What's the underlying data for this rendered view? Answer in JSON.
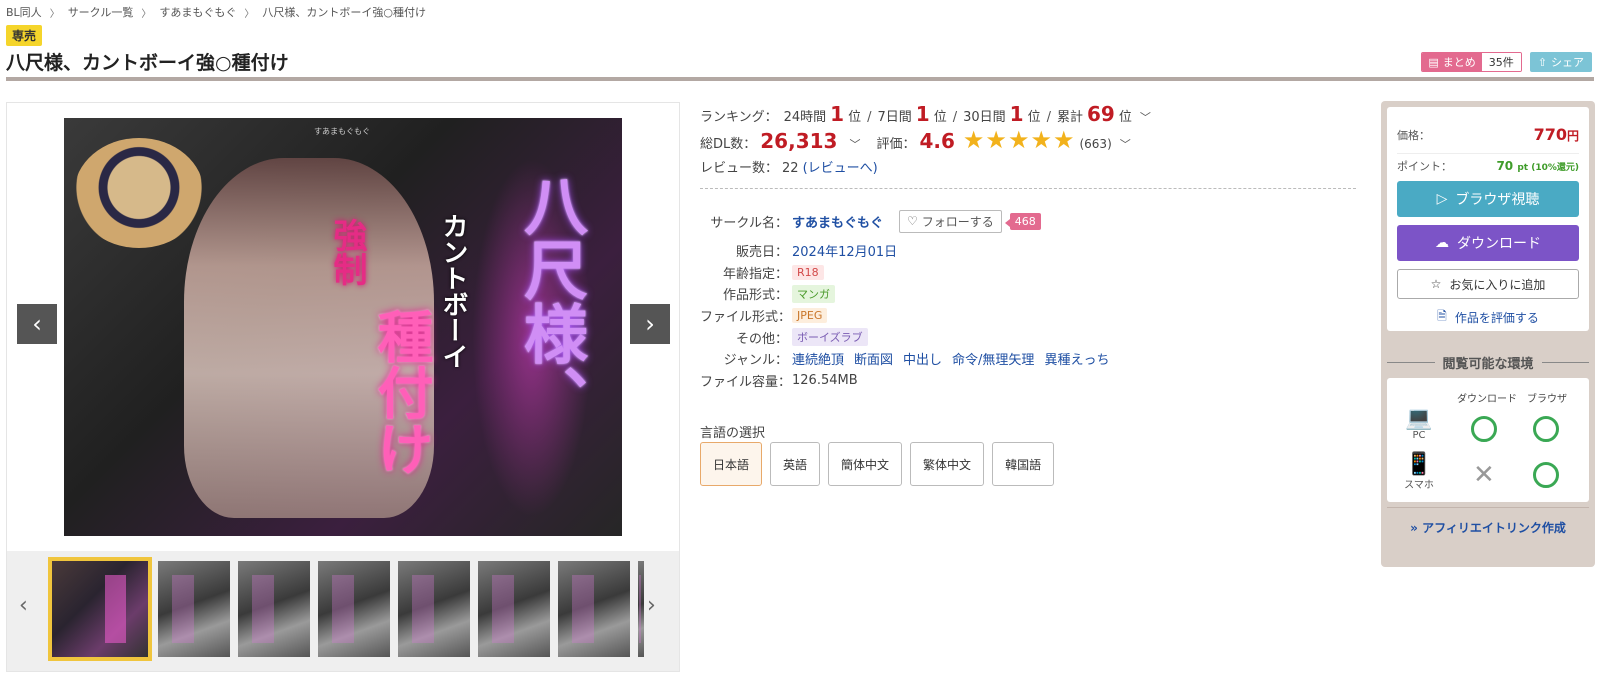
{
  "breadcrumb": [
    "BL同人",
    "サークル一覧",
    "すあまもぐもぐ",
    "八尺様、カントボーイ強○種付け"
  ],
  "badge": "専売",
  "title": "八尺様、カントボーイ強○種付け",
  "top_actions": {
    "matome_label": "まとめ",
    "matome_count": "35件",
    "share_label": "シェア"
  },
  "cover": {
    "small": "すあまもぐもぐ",
    "t1": "八尺様、",
    "t2": "カントボーイ",
    "t3": "種付け",
    "t4": "強制"
  },
  "ranking": {
    "label": "ランキング：",
    "h24_label": "24時間",
    "h24": "1",
    "d7_label": "7日間",
    "d7": "1",
    "d30_label": "30日間",
    "d30": "1",
    "total_label": "累計",
    "total": "69",
    "unit": "位"
  },
  "downloads": {
    "label": "総DL数：",
    "value": "26,313"
  },
  "rating": {
    "label": "評価：",
    "value": "4.6",
    "stars": "★★★★★",
    "count": "(663)"
  },
  "reviews": {
    "label": "レビュー数：",
    "count": "22",
    "link": "(レビューへ)"
  },
  "spec": {
    "circle_label": "サークル名：",
    "circle": "すあまもぐもぐ",
    "follow_label": "フォローする",
    "follow_count": "468",
    "date_label": "販売日：",
    "date": "2024年12月01日",
    "age_label": "年齢指定：",
    "age": "R18",
    "format_label": "作品形式：",
    "format": "マンガ",
    "file_label": "ファイル形式：",
    "file": "JPEG",
    "other_label": "その他：",
    "other": "ボーイズラブ",
    "genre_label": "ジャンル：",
    "genres": [
      "連続絶頂",
      "断面図",
      "中出し",
      "命令/無理矢理",
      "異種えっち"
    ],
    "size_label": "ファイル容量：",
    "size": "126.54MB"
  },
  "language": {
    "title": "言語の選択",
    "options": [
      "日本語",
      "英語",
      "簡体中文",
      "繁体中文",
      "韓国語"
    ],
    "selected": 0
  },
  "purchase": {
    "price_label": "価格：",
    "price": "770",
    "price_unit": "円",
    "point_label": "ポイント：",
    "point": "70",
    "point_note": "pt (10%還元)",
    "browser_label": "ブラウザ視聴",
    "download_label": "ダウンロード",
    "favorite_label": "お気に入りに追加",
    "rate_label": "作品を評価する"
  },
  "environment": {
    "title": "閲覧可能な環境",
    "col_download": "ダウンロード",
    "col_browser": "ブラウザ",
    "pc": "PC",
    "sp": "スマホ",
    "ng_mark": "✕"
  },
  "affiliate": "» アフィリエイトリンク作成",
  "colors": {
    "accent_red": "#c01c24",
    "browser_btn": "#4aaac4",
    "download_btn": "#7c54c7",
    "ok_green": "#3aa854",
    "pink": "#e36a8f"
  }
}
